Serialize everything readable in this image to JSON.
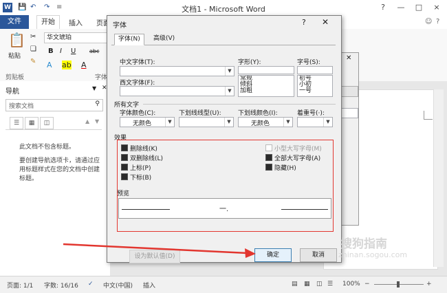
{
  "window": {
    "title": "文档1 - Microsoft Word",
    "controls": [
      "?",
      "—",
      "□",
      "×"
    ]
  },
  "ribbon": {
    "tabs": {
      "file": "文件",
      "home": "开始",
      "insert": "插入",
      "page": "页面"
    },
    "font_name": "华文琥珀",
    "paste_label": "粘贴",
    "clipboard_label": "剪贴板",
    "font_group_label": "字体"
  },
  "nav": {
    "title": "导航",
    "search_placeholder": "搜索文档",
    "empty_msg": "此文档不包含标题。",
    "help_msg": "要创建导航选项卡，请通过应用标题样式在您的文档中创建标题。"
  },
  "dialog": {
    "title": "字体",
    "tabs": [
      "字体(N)",
      "高级(V)"
    ],
    "cn_font_label": "中文字体(T):",
    "west_font_label": "西文字体(F):",
    "style_label": "字形(Y):",
    "size_label": "字号(S):",
    "styles": [
      "常规",
      "倾斜",
      "加粗"
    ],
    "sizes": [
      "初号",
      "小初",
      "一号"
    ],
    "all_text_label": "所有文字",
    "font_color_label": "字体颜色(C):",
    "font_color_value": "无颜色",
    "underline_label": "下划线线型(U):",
    "underline_color_label": "下划线颜色(I):",
    "underline_color_value": "无颜色",
    "emphasis_label": "着重号(·):",
    "effects_label": "效果",
    "effects_left": [
      "删除线(K)",
      "双删除线(L)",
      "上标(P)",
      "下标(B)"
    ],
    "effects_right": [
      "小型大写字母(M)",
      "全部大写字母(A)",
      "隐藏(H)"
    ],
    "preview_label": "预览",
    "preview_text": "一.",
    "set_default": "设为默认值(D)",
    "ok": "确定",
    "cancel": "取消"
  },
  "status": {
    "page": "页面: 1/1",
    "words": "字数: 16/16",
    "lang": "中文(中国)",
    "mode": "插入",
    "zoom": "100%"
  },
  "watermark": {
    "main": "搜狗指南",
    "sub": "zhinan.sogou.com"
  },
  "colors": {
    "accent": "#2b579a",
    "highlight_red": "#e2362f",
    "dialog_bg": "#f0f0f0"
  }
}
